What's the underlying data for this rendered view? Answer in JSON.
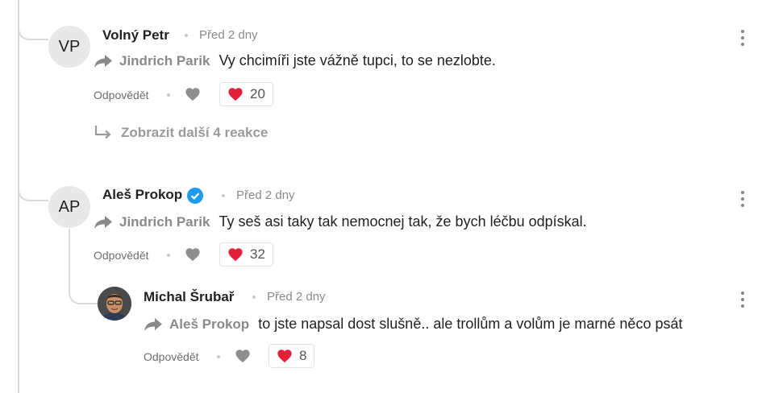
{
  "comments": [
    {
      "initials": "VP",
      "author": "Volný Petr",
      "time": "Před 2 dny",
      "reply_to": "Jindrich Parik",
      "text": "Vy chcimíři jste vážně tupci, to se nezlobte.",
      "reply_label": "Odpovědět",
      "likes": "20",
      "more_replies": "Zobrazit další 4 reakce"
    },
    {
      "initials": "AP",
      "author": "Aleš Prokop",
      "verified": true,
      "time": "Před 2 dny",
      "reply_to": "Jindrich Parik",
      "text": "Ty seš asi taky tak nemocnej tak, že bych léčbu odpískal.",
      "reply_label": "Odpovědět",
      "likes": "32"
    },
    {
      "author": "Michal Šrubař",
      "time": "Před 2 dny",
      "reply_to": "Aleš Prokop",
      "text": "to jste napsal dost slušně.. ale trollům a volům je marné něco psát",
      "reply_label": "Odpovědět",
      "likes": "8"
    }
  ],
  "colors": {
    "heart": "#e2203c",
    "verified": "#1d9bf0",
    "thread_line": "#d9d9d9"
  }
}
